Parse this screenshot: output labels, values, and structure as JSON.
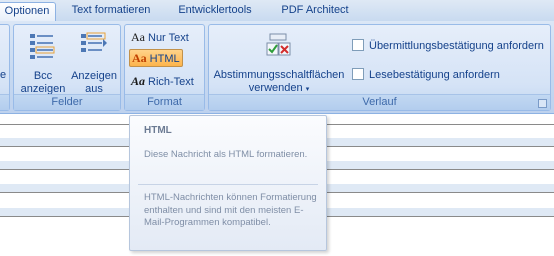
{
  "tabs": [
    {
      "label": "Optionen",
      "active": true
    },
    {
      "label": "Text formatieren",
      "active": false
    },
    {
      "label": "Entwicklertools",
      "active": false
    },
    {
      "label": "PDF Architect",
      "active": false
    }
  ],
  "groups": {
    "felder": {
      "label": "Felder",
      "bcc_line1": "Bcc",
      "bcc_line2": "anzeigen",
      "from_line1": "Anzeigen",
      "from_line2": "aus",
      "cutoff_char": "e"
    },
    "format": {
      "label": "Format",
      "plain_text": "Nur Text",
      "html": "HTML",
      "rich_text": "Rich-Text",
      "aa_glyph": "Aa",
      "selected": "HTML"
    },
    "verlauf": {
      "label": "Verlauf",
      "voting_line1": "Abstimmungsschaltflächen",
      "voting_line2": "verwenden",
      "delivery_receipt": "Übermittlungsbestätigung anfordern",
      "read_receipt": "Lesebestätigung anfordern",
      "delivery_checked": false,
      "read_checked": false
    }
  },
  "tooltip": {
    "title": "HTML",
    "para1": "Diese Nachricht als HTML formatieren.",
    "para2": "HTML-Nachrichten können Formatierung enthalten und sind mit den meisten E-Mail-Programmen kompatibel."
  },
  "colors": {
    "ribbon_text": "#15428b",
    "selected_button": "#fdb44c",
    "tooltip_text": "#7f8ea6"
  }
}
